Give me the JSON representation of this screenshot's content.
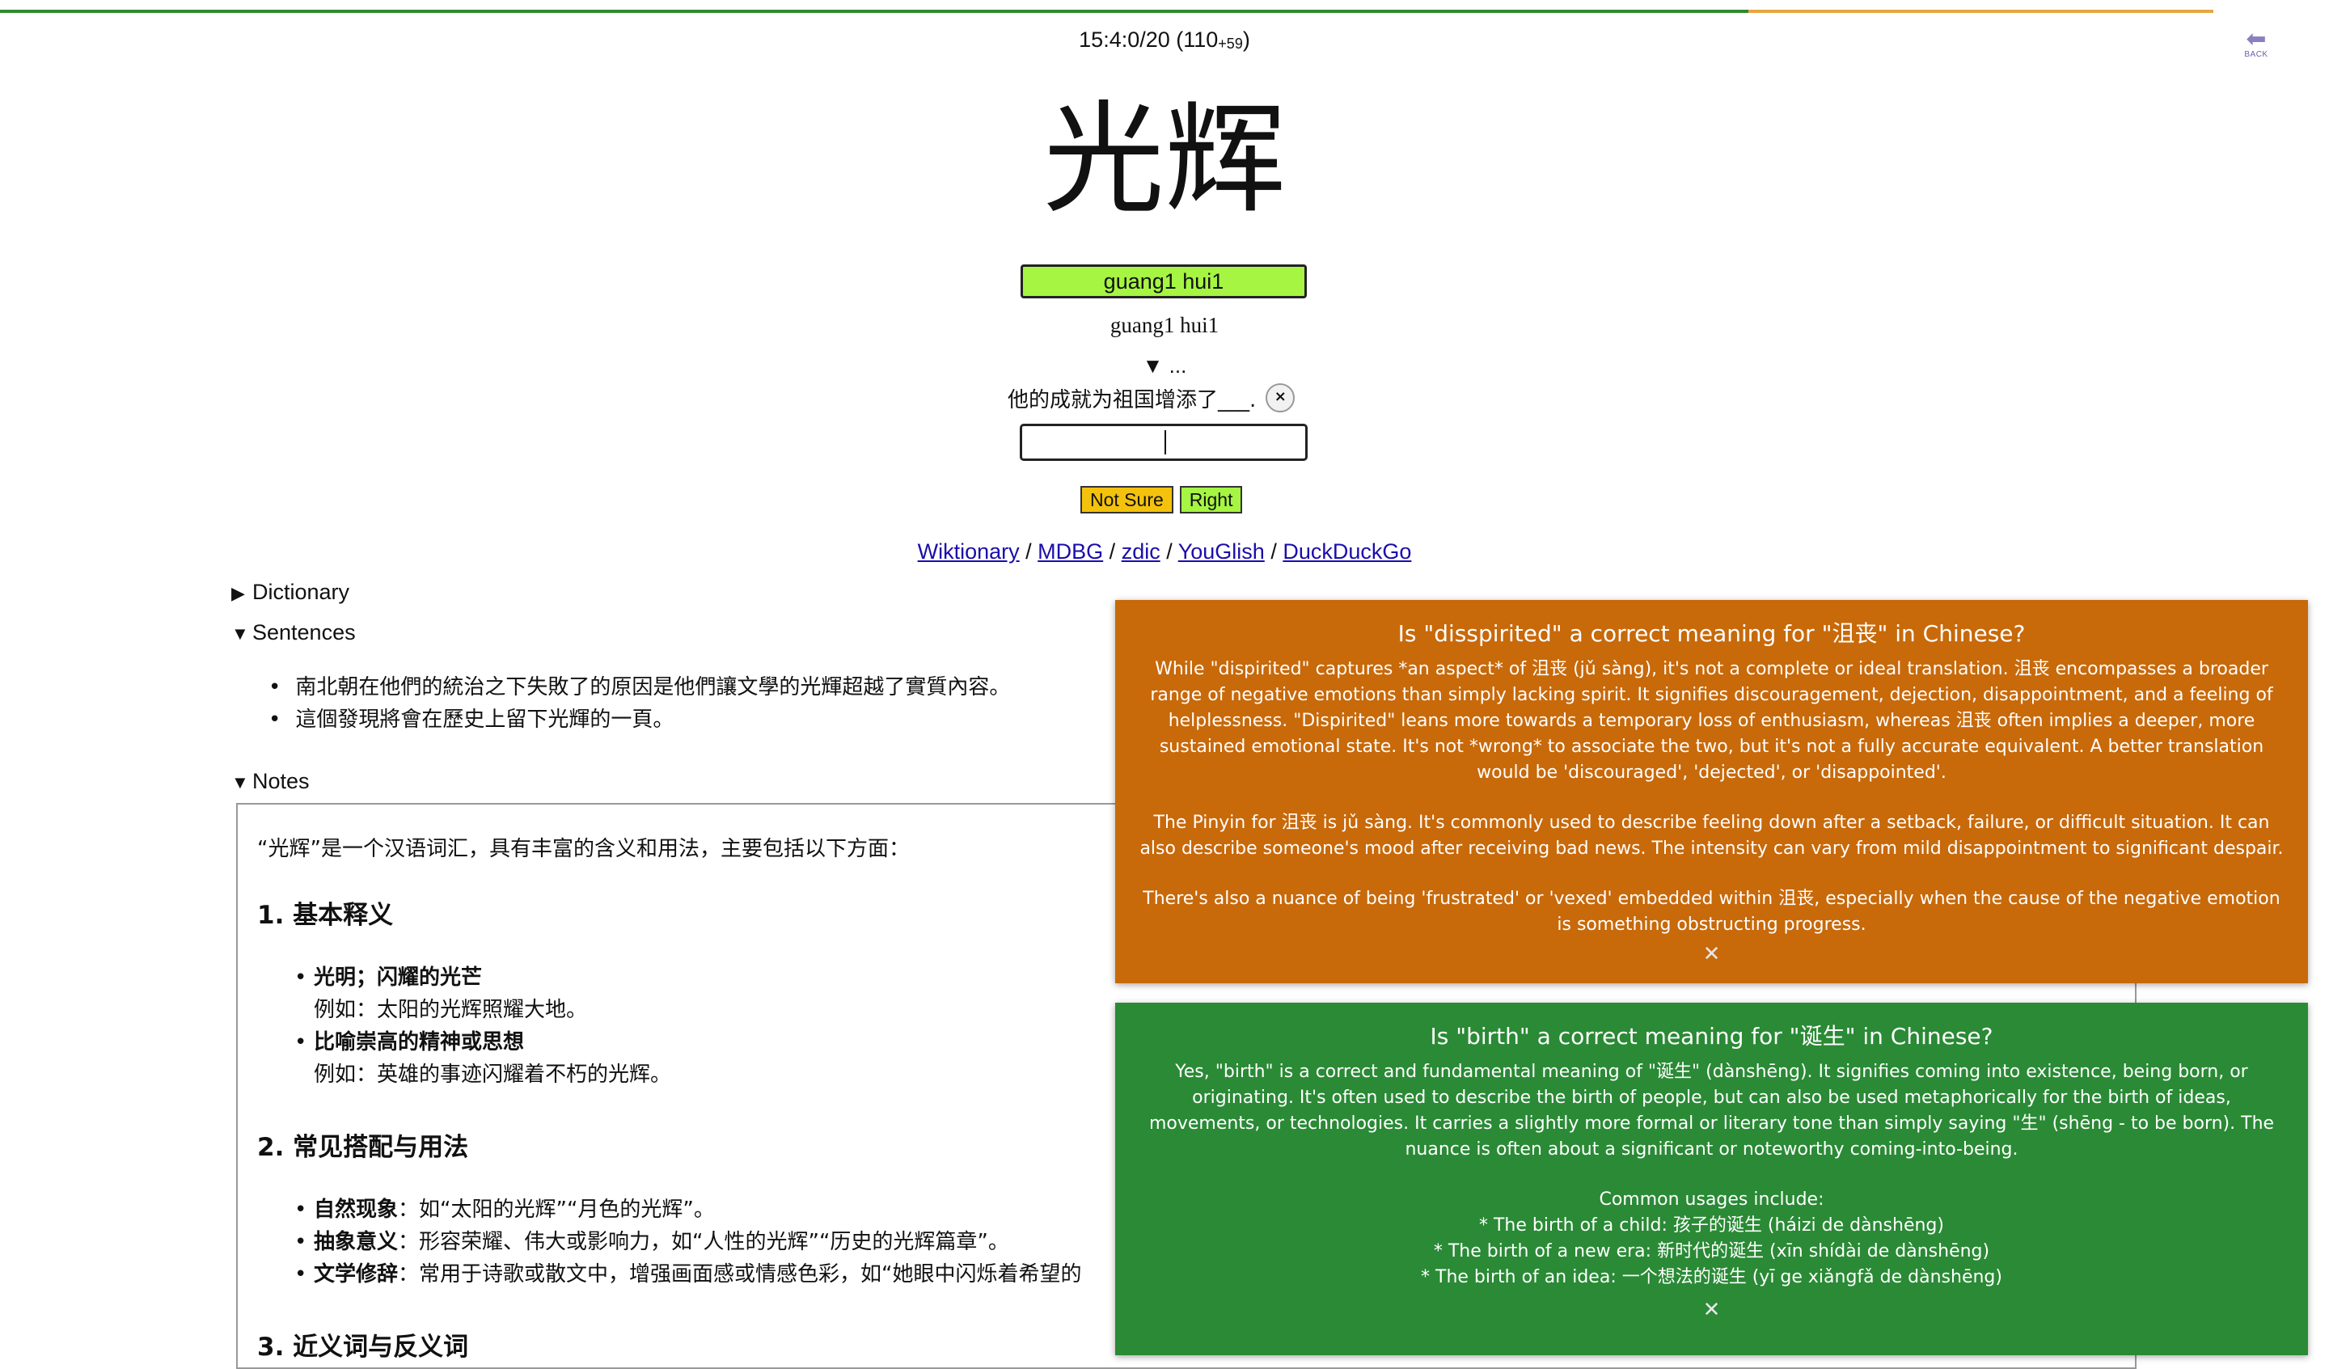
{
  "progress": {
    "fraction": 0.79,
    "done_color": "#2f8a2f",
    "remain_color": "#e8a640"
  },
  "status": {
    "clock": "15:4:0/20 (110",
    "extra": "+59",
    "close": ")"
  },
  "back_button": {
    "icon": "back-arrow-icon",
    "label": "BACK"
  },
  "word": {
    "hanzi": "光辉",
    "pinyin_highlight": "guang1 hui1",
    "pinyin_plain": "guang1 hui1"
  },
  "cloze": {
    "toggle": "▼ ...",
    "sentence": "他的成就为祖国增添了___.",
    "clear": "×"
  },
  "answer": {
    "value": "",
    "placeholder": ""
  },
  "buttons": {
    "not_sure": "Not Sure",
    "right": "Right"
  },
  "links": [
    "Wiktionary",
    "MDBG",
    "zdic",
    "YouGlish",
    "DuckDuckGo"
  ],
  "sections": {
    "dictionary": "Dictionary",
    "sentences": "Sentences",
    "notes": "Notes"
  },
  "sentences": [
    "南北朝在他們的統治之下失敗了的原因是他們讓文學的光輝超越了實質內容。",
    "這個發現將會在歷史上留下光輝的一頁。"
  ],
  "notes": {
    "intro": "“光辉”是一个汉语词汇，具有丰富的含义和用法，主要包括以下方面：",
    "h1": "1. 基本释义",
    "s1_b1": "光明；闪耀的光芒",
    "s1_e1": "例如：太阳的光辉照耀大地。",
    "s1_b2": "比喻崇高的精神或思想",
    "s1_e2": "例如：英雄的事迹闪耀着不朽的光辉。",
    "h2": "2. 常见搭配与用法",
    "s2_b1_k": "自然现象",
    "s2_b1_v": "：如“太阳的光辉”“月色的光辉”。",
    "s2_b2_k": "抽象意义",
    "s2_b2_v": "：形容荣耀、伟大或影响力，如“人性的光辉”“历史的光辉篇章”。",
    "s2_b3_k": "文学修辞",
    "s2_b3_v": "：常用于诗歌或散文中，增强画面感或情感色彩，如“她眼中闪烁着希望的",
    "h3": "3. 近义词与反义词"
  },
  "popup_orange": {
    "title": "Is \"disspirited\" a correct meaning for \"沮丧\" in Chinese?",
    "p1": "While \"dispirited\" captures *an aspect* of 沮丧 (jǔ sàng), it's not a complete or ideal translation. 沮丧 encompasses a broader range of negative emotions than simply lacking spirit. It signifies discouragement, dejection, disappointment, and a feeling of helplessness. \"Dispirited\" leans more towards a temporary loss of enthusiasm, whereas 沮丧 often implies a deeper, more sustained emotional state. It's not *wrong* to associate the two, but it's not a fully accurate equivalent. A better translation would be 'discouraged', 'dejected', or 'disappointed'.",
    "p2": "The Pinyin for 沮丧 is jǔ sàng. It's commonly used to describe feeling down after a setback, failure, or difficult situation. It can also describe someone's mood after receiving bad news. The intensity can vary from mild disappointment to significant despair.",
    "p3": "There's also a nuance of being 'frustrated' or 'vexed' embedded within 沮丧, especially when the cause of the negative emotion is something obstructing progress.",
    "close": "✕",
    "color": "#c8690a"
  },
  "popup_green": {
    "title": "Is \"birth\" a correct meaning for \"诞生\" in Chinese?",
    "p1": "Yes, \"birth\" is a correct and fundamental meaning of \"诞生\" (dànshēng). It signifies coming into existence, being born, or originating. It's often used to describe the birth of people, but can also be used metaphorically for the birth of ideas, movements, or technologies. It carries a slightly more formal or literary tone than simply saying \"生\" (shēng - to be born). The nuance is often about a significant or noteworthy coming-into-being.",
    "usages_title": "Common usages include:",
    "usage1": "* The birth of a child: 孩子的诞生 (háizi de dànshēng)",
    "usage2": "* The birth of a new era: 新时代的诞生 (xīn shídài de dànshēng)",
    "usage3": "* The birth of an idea: 一个想法的诞生 (yī ge xiǎngfǎ de dànshēng)",
    "close": "✕",
    "color": "#2a8a35"
  }
}
